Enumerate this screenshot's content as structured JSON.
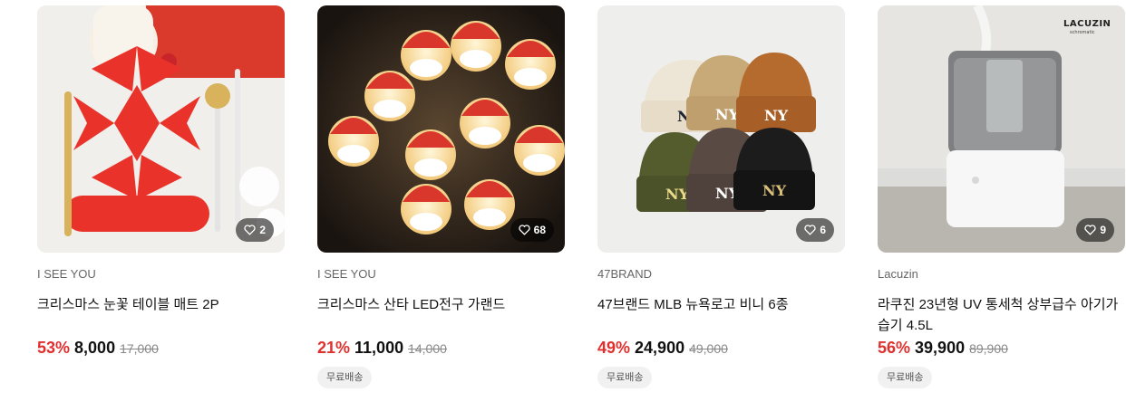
{
  "products": [
    {
      "brand": "I SEE YOU",
      "title": "크리스마스 눈꽃 테이블 매트 2P",
      "discount": "53%",
      "price": "8,000",
      "original_price": "17,000",
      "likes": "2",
      "shipping_badge": ""
    },
    {
      "brand": "I SEE YOU",
      "title": "크리스마스 산타 LED전구 가랜드",
      "discount": "21%",
      "price": "11,000",
      "original_price": "14,000",
      "likes": "68",
      "shipping_badge": "무료배송"
    },
    {
      "brand": "47BRAND",
      "title": "47브랜드 MLB 뉴욕로고 비니 6종",
      "discount": "49%",
      "price": "24,900",
      "original_price": "49,000",
      "likes": "6",
      "shipping_badge": "무료배송"
    },
    {
      "brand": "Lacuzin",
      "title": "라쿠진 23년형 UV 통세척 상부급수 아기가습기 4.5L",
      "discount": "56%",
      "price": "39,900",
      "original_price": "89,900",
      "likes": "9",
      "shipping_badge": "무료배송",
      "image_logo_text": "LACUZIN",
      "image_logo_sub": "schromatic"
    }
  ],
  "colors": {
    "discount": "#e0302e",
    "badge_bg": "#f1f1f1"
  },
  "icons": {
    "like": "heart-outline-icon"
  }
}
